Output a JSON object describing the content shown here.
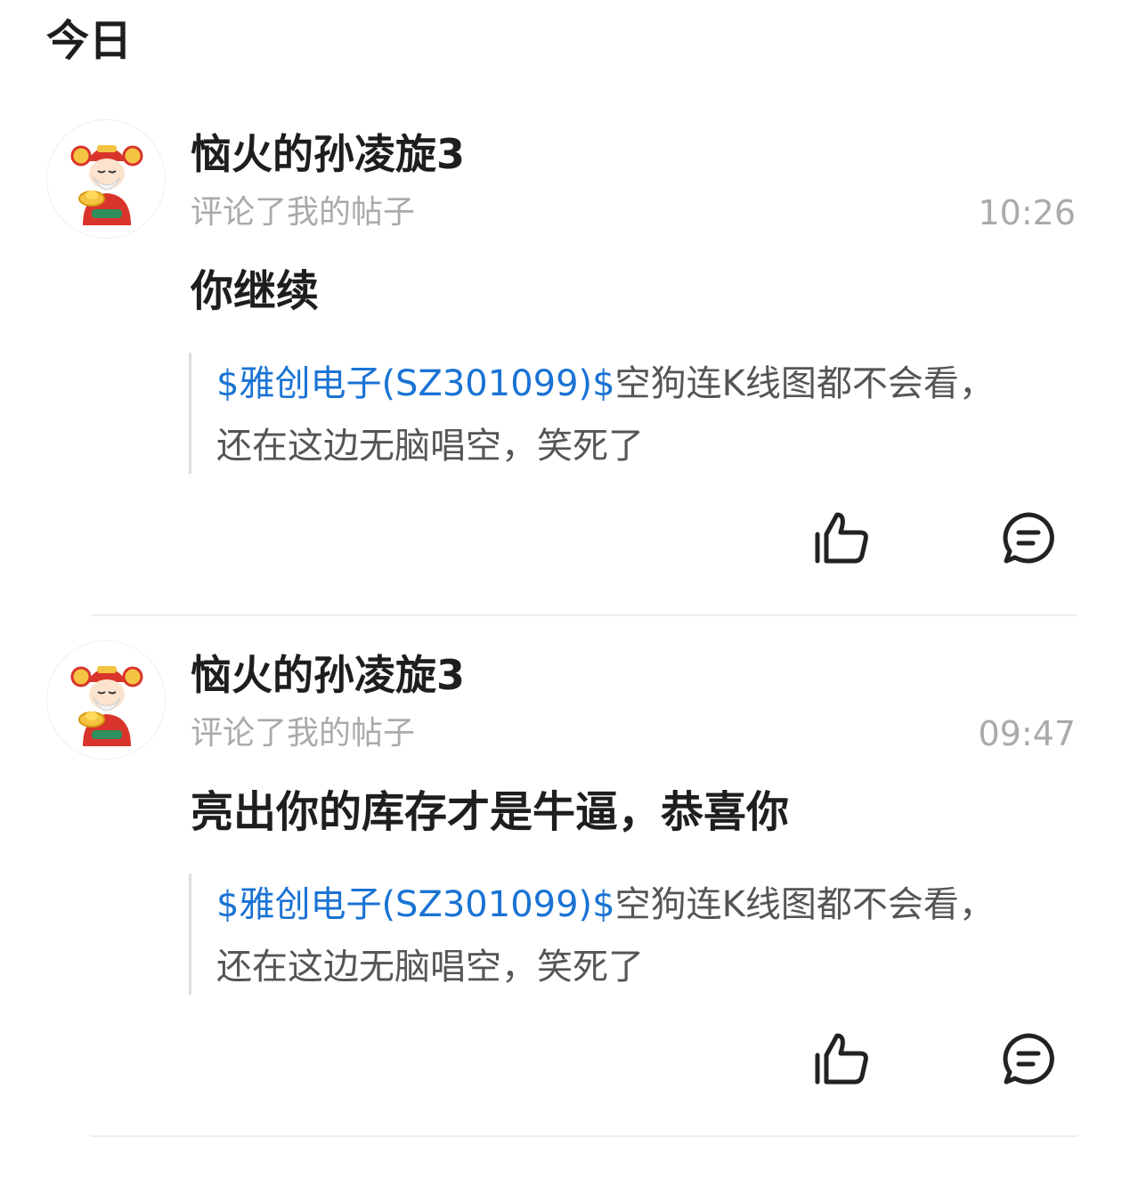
{
  "section": {
    "title": "今日"
  },
  "notifications": [
    {
      "user_name": "恼火的孙凌旋3",
      "action": "评论了我的帖子",
      "time": "10:26",
      "comment": "你继续",
      "quote": {
        "stock_tag": "$雅创电子(SZ301099)$",
        "text": "空狗连K线图都不会看，还在这边无脑唱空，笑死了"
      },
      "avatar_icon": "god-of-wealth-avatar-icon",
      "like_icon": "thumbs-up-icon",
      "reply_icon": "comment-bubble-icon"
    },
    {
      "user_name": "恼火的孙凌旋3",
      "action": "评论了我的帖子",
      "time": "09:47",
      "comment": "亮出你的库存才是牛逼，恭喜你",
      "quote": {
        "stock_tag": "$雅创电子(SZ301099)$",
        "text": "空狗连K线图都不会看，还在这边无脑唱空，笑死了"
      },
      "avatar_icon": "god-of-wealth-avatar-icon",
      "like_icon": "thumbs-up-icon",
      "reply_icon": "comment-bubble-icon"
    }
  ],
  "colors": {
    "link": "#1a73d4",
    "secondary_text": "#aaaaaa",
    "primary_text": "#1e1e1e",
    "quote_bar": "#dddddd",
    "divider": "#eeeeee"
  }
}
